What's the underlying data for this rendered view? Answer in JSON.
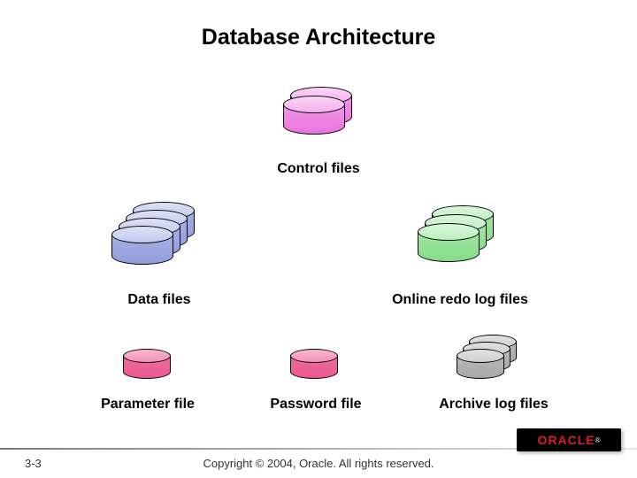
{
  "title": "Database Architecture",
  "labels": {
    "control": "Control files",
    "data": "Data files",
    "redo": "Online redo log files",
    "parameter": "Parameter file",
    "password": "Password file",
    "archive": "Archive log files"
  },
  "footer": {
    "page": "3-3",
    "copyright": "Copyright © 2004, Oracle. All rights reserved.",
    "logo": "ORACLE"
  },
  "diagram": {
    "groups": [
      {
        "name": "control-files",
        "color": "pink",
        "count": 2
      },
      {
        "name": "data-files",
        "color": "blue",
        "count": 4
      },
      {
        "name": "online-redo-log-files",
        "color": "green",
        "count": 3
      },
      {
        "name": "parameter-file",
        "color": "rose",
        "count": 1
      },
      {
        "name": "password-file",
        "color": "rose",
        "count": 1
      },
      {
        "name": "archive-log-files",
        "color": "gray",
        "count": 3
      }
    ]
  }
}
